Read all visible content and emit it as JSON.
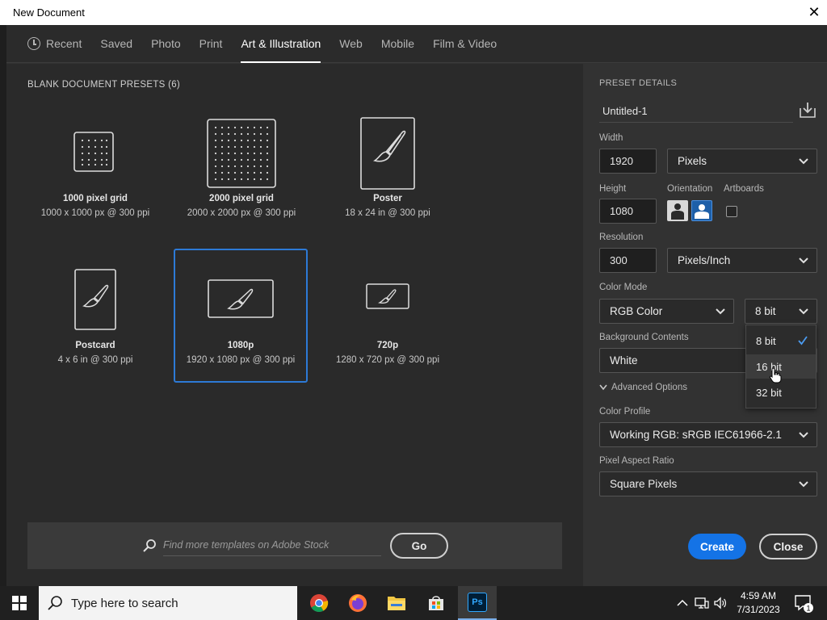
{
  "window": {
    "title": "New Document",
    "close_glyph": "✕"
  },
  "tabs": [
    {
      "label": "Recent",
      "icon": "clock-icon"
    },
    {
      "label": "Saved"
    },
    {
      "label": "Photo"
    },
    {
      "label": "Print"
    },
    {
      "label": "Art & Illustration",
      "active": true
    },
    {
      "label": "Web"
    },
    {
      "label": "Mobile"
    },
    {
      "label": "Film & Video"
    }
  ],
  "presets": {
    "title": "BLANK DOCUMENT PRESETS  (6)",
    "items": [
      {
        "name": "1000 pixel grid",
        "spec": "1000 x 1000 px @ 300 ppi"
      },
      {
        "name": "2000 pixel grid",
        "spec": "2000 x 2000 px @ 300 ppi"
      },
      {
        "name": "Poster",
        "spec": "18 x 24 in @ 300 ppi"
      },
      {
        "name": "Postcard",
        "spec": "4 x 6 in @ 300 ppi"
      },
      {
        "name": "1080p",
        "spec": "1920 x 1080 px @ 300 ppi",
        "selected": true
      },
      {
        "name": "720p",
        "spec": "1280 x 720 px @ 300 ppi"
      }
    ]
  },
  "stock": {
    "placeholder": "Find more templates on Adobe Stock",
    "go_label": "Go"
  },
  "details": {
    "section_title": "PRESET DETAILS",
    "doc_name": "Untitled-1",
    "width_label": "Width",
    "width_value": "1920",
    "width_unit": "Pixels",
    "height_label": "Height",
    "height_value": "1080",
    "orientation_label": "Orientation",
    "artboards_label": "Artboards",
    "resolution_label": "Resolution",
    "resolution_value": "300",
    "resolution_unit": "Pixels/Inch",
    "color_mode_label": "Color Mode",
    "color_mode_value": "RGB Color",
    "bit_depth_value": "8 bit",
    "bg_label": "Background Contents",
    "bg_value": "White",
    "advanced_label": "Advanced Options",
    "profile_label": "Color Profile",
    "profile_value": "Working RGB: sRGB IEC61966-2.1",
    "aspect_label": "Pixel Aspect Ratio",
    "aspect_value": "Square Pixels",
    "create_label": "Create",
    "close_label": "Close"
  },
  "bit_dropdown": {
    "options": [
      "8 bit",
      "16 bit",
      "32 bit"
    ],
    "selected": "8 bit",
    "hovered": "16 bit"
  },
  "taskbar": {
    "search_placeholder": "Type here to search",
    "apps": [
      "chrome-icon",
      "firefox-icon",
      "file-explorer-icon",
      "store-icon",
      "photoshop-icon"
    ],
    "photoshop_label": "Ps",
    "time": "4:59 AM",
    "date": "7/31/2023",
    "notification_count": "1"
  },
  "colors": {
    "accent": "#1473e6",
    "selected_border": "#2d7ad6",
    "panel": "#323232",
    "canvas": "#2a2a2a"
  }
}
